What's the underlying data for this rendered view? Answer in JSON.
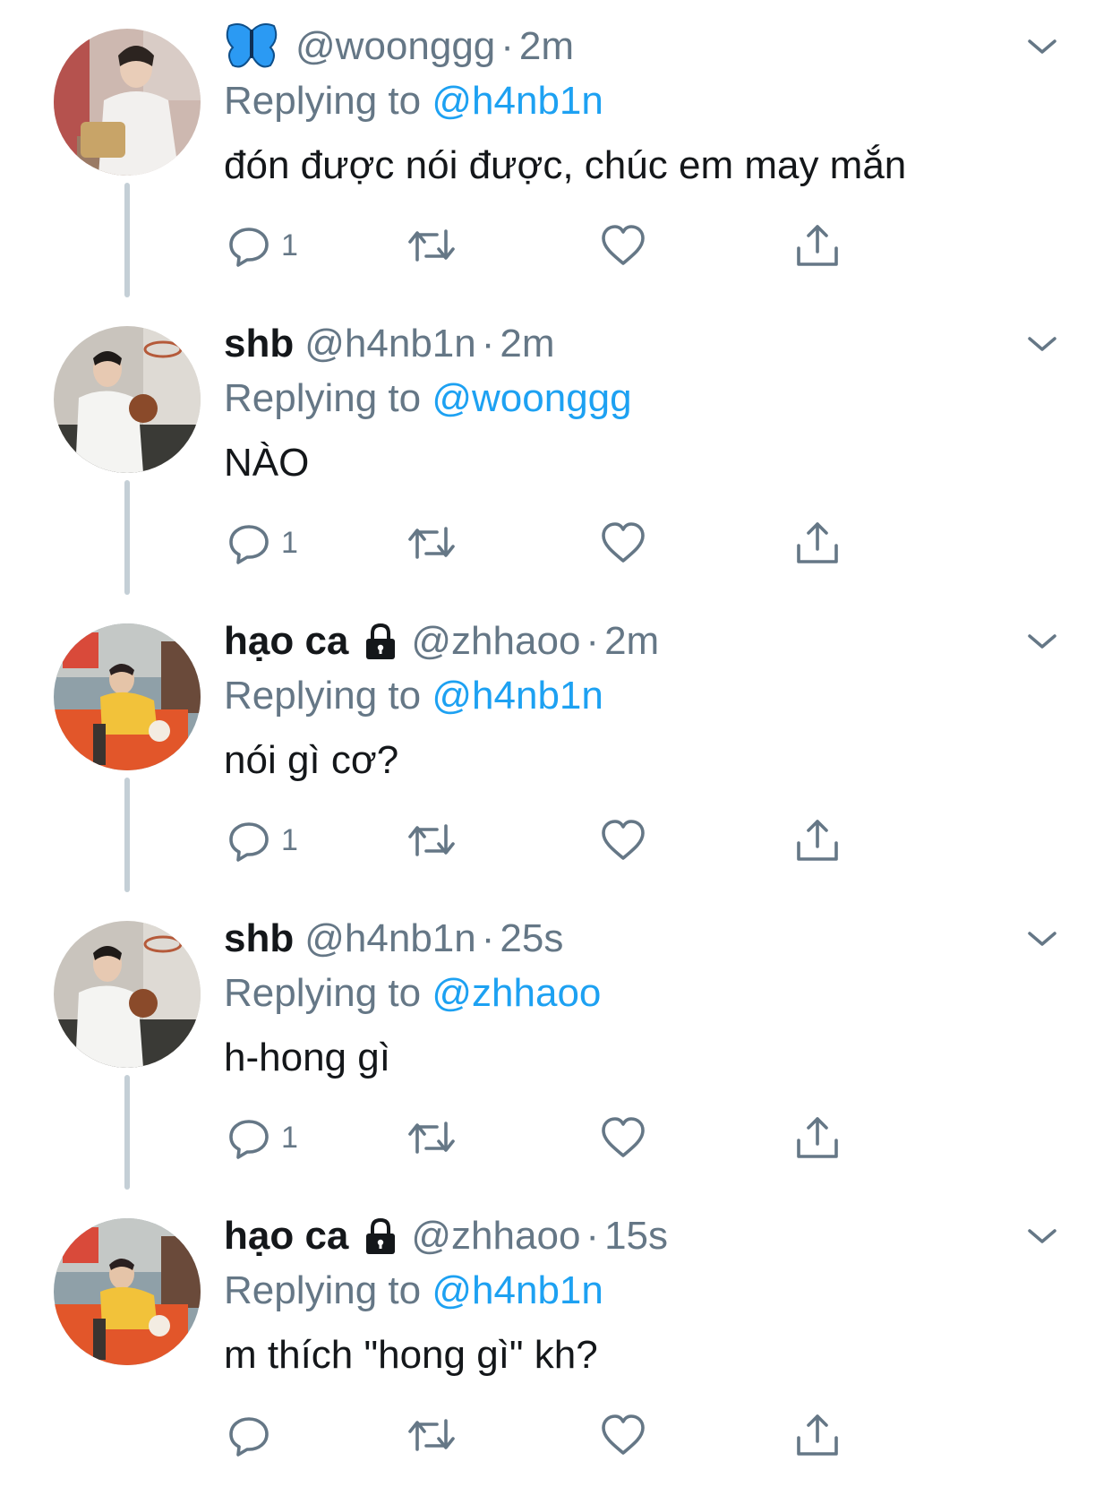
{
  "tweets": [
    {
      "name": "",
      "handle": "@woonggg",
      "separator": "·",
      "time": "2m",
      "replying_prefix": "Replying to ",
      "replying_to": "@h4nb1n",
      "text": "đón được nói được, chúc em may mắn",
      "reply_count": "1",
      "has_butterfly": true,
      "locked": false
    },
    {
      "name": "shb",
      "handle": "@h4nb1n",
      "separator": "·",
      "time": "2m",
      "replying_prefix": "Replying to ",
      "replying_to": "@woonggg",
      "text": "NÀO",
      "reply_count": "1",
      "has_butterfly": false,
      "locked": false
    },
    {
      "name": "hạo ca",
      "handle": "@zhhaoo",
      "separator": "·",
      "time": "2m",
      "replying_prefix": "Replying to ",
      "replying_to": "@h4nb1n",
      "text": "nói gì cơ?",
      "reply_count": "1",
      "has_butterfly": false,
      "locked": true
    },
    {
      "name": "shb",
      "handle": "@h4nb1n",
      "separator": "·",
      "time": "25s",
      "replying_prefix": "Replying to ",
      "replying_to": "@zhhaoo",
      "text": "h-hong gì",
      "reply_count": "1",
      "has_butterfly": false,
      "locked": false
    },
    {
      "name": "hạo ca",
      "handle": "@zhhaoo",
      "separator": "·",
      "time": "15s",
      "replying_prefix": "Replying to ",
      "replying_to": "@h4nb1n",
      "text": "m thích \"hong gì\" kh?",
      "reply_count": "",
      "has_butterfly": false,
      "locked": true
    }
  ],
  "colors": {
    "text_primary": "#14171a",
    "text_secondary": "#657786",
    "mention": "#1da1f2",
    "thread_line": "#c4cfd6",
    "butterfly": "#1da1f2"
  },
  "icons": [
    "butterfly-icon",
    "lock-icon",
    "reply-icon",
    "retweet-icon",
    "like-icon",
    "share-icon",
    "caret-down-icon"
  ]
}
